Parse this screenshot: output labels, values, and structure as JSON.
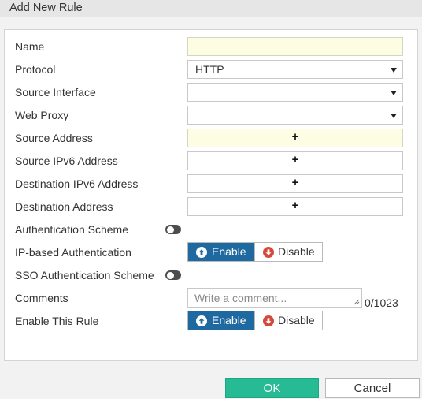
{
  "dialog": {
    "title": "Add New Rule"
  },
  "form": {
    "name_label": "Name",
    "name_value": "",
    "protocol_label": "Protocol",
    "protocol_value": "HTTP",
    "source_interface_label": "Source Interface",
    "source_interface_value": "",
    "web_proxy_label": "Web Proxy",
    "web_proxy_value": "",
    "source_address_label": "Source Address",
    "source_ipv6_label": "Source IPv6 Address",
    "dest_ipv6_label": "Destination IPv6 Address",
    "dest_address_label": "Destination Address",
    "add_symbol": "+",
    "auth_scheme_label": "Authentication Scheme",
    "auth_scheme_enabled": false,
    "ip_auth_label": "IP-based Authentication",
    "ip_auth_state": "Enable",
    "sso_auth_label": "SSO Authentication Scheme",
    "sso_auth_enabled": false,
    "comments_label": "Comments",
    "comments_placeholder": "Write a comment...",
    "comments_counter": "0/1023",
    "enable_rule_label": "Enable This Rule",
    "enable_rule_state": "Enable"
  },
  "segmented": {
    "enable_label": "Enable",
    "disable_label": "Disable"
  },
  "footer": {
    "ok_label": "OK",
    "cancel_label": "Cancel"
  },
  "colors": {
    "accent_blue": "#1e6aa0",
    "ok_green": "#26bb94",
    "disable_red": "#d44a3a",
    "required_field_bg": "#fdfde3"
  },
  "icons": {
    "dropdown": "caret-down-icon",
    "add": "plus-icon",
    "enable": "arrow-up-circle-icon",
    "disable": "arrow-down-circle-icon",
    "toggle": "toggle-switch-icon",
    "resize": "resize-handle-icon"
  }
}
